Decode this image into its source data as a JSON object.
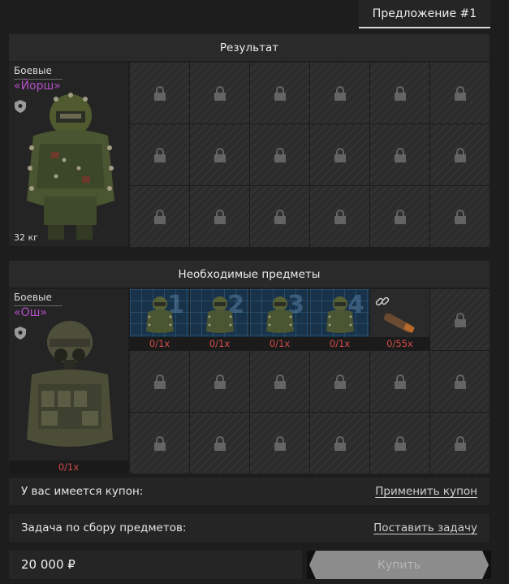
{
  "tab": {
    "label": "Предложение #1"
  },
  "result": {
    "header": "Результат",
    "item": {
      "category": "Боевые",
      "name": "«Йорш»",
      "weight": "32 кг"
    }
  },
  "required": {
    "header": "Необходимые предметы",
    "item": {
      "category": "Боевые",
      "name": "«Ош»",
      "count": "0/1x"
    },
    "slots": [
      {
        "number": "1",
        "count": "0/1x"
      },
      {
        "number": "2",
        "count": "0/1x"
      },
      {
        "number": "3",
        "count": "0/1x"
      },
      {
        "number": "4",
        "count": "0/1x"
      },
      {
        "count": "0/55x"
      }
    ]
  },
  "coupon": {
    "label": "У вас имеется купон:",
    "action": "Применить купон"
  },
  "task": {
    "label": "Задача по сбору предметов:",
    "action": "Поставить задачу"
  },
  "price": "20 000 ₽",
  "buy_label": "Купить",
  "colors": {
    "accent_name": "#b450c8",
    "count_red": "#d84a4a"
  }
}
